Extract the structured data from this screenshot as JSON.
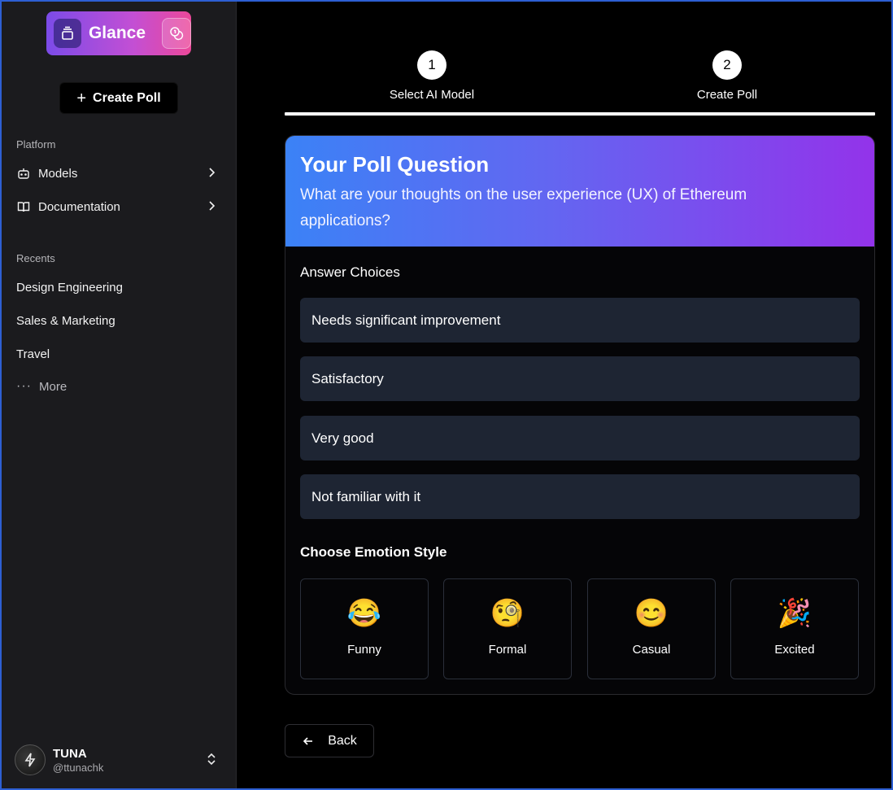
{
  "app": {
    "name": "Glance"
  },
  "sidebar": {
    "create_button": "Create Poll",
    "platform_label": "Platform",
    "platform_items": [
      {
        "label": "Models",
        "icon": "bot-icon"
      },
      {
        "label": "Documentation",
        "icon": "book-icon"
      }
    ],
    "recents_label": "Recents",
    "recents": [
      "Design Engineering",
      "Sales & Marketing",
      "Travel"
    ],
    "more_label": "More",
    "user": {
      "name": "TUNA",
      "handle": "@ttunachk"
    }
  },
  "stepper": {
    "steps": [
      {
        "number": "1",
        "label": "Select AI Model"
      },
      {
        "number": "2",
        "label": "Create Poll"
      }
    ]
  },
  "poll": {
    "title": "Your Poll Question",
    "question": "What are your thoughts on the user experience (UX) of Ethereum applications?",
    "answers_label": "Answer Choices",
    "answers": [
      "Needs significant improvement",
      "Satisfactory",
      "Very good",
      "Not familiar with it"
    ],
    "emotion_label": "Choose Emotion Style",
    "emotions": [
      {
        "emoji": "😂",
        "label": "Funny"
      },
      {
        "emoji": "🧐",
        "label": "Formal"
      },
      {
        "emoji": "😊",
        "label": "Casual"
      },
      {
        "emoji": "🎉",
        "label": "Excited"
      }
    ]
  },
  "footer": {
    "back_label": "Back"
  },
  "colors": {
    "header_gradient_start": "#3b82f6",
    "header_gradient_end": "#9333ea",
    "logo_gradient_start": "#7b4be8",
    "logo_gradient_end": "#ec4899",
    "answer_bg": "#1e2533"
  }
}
